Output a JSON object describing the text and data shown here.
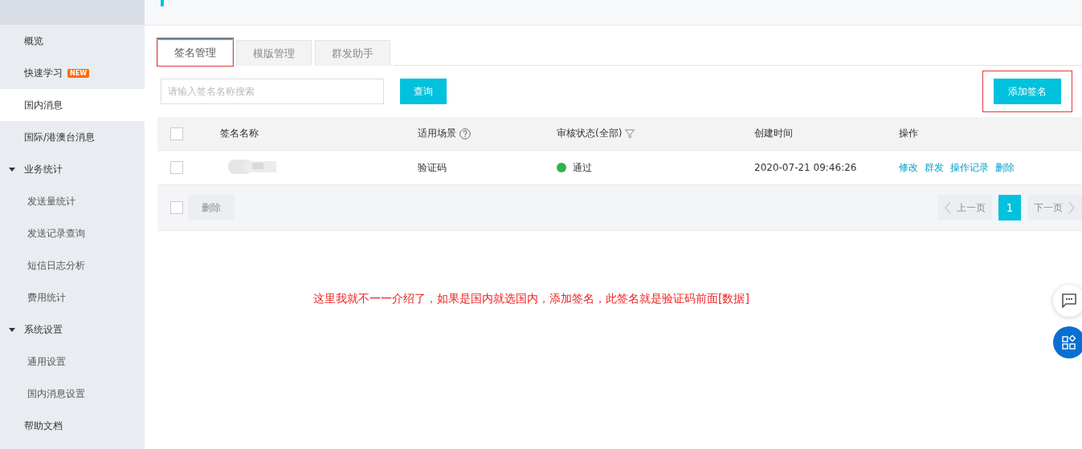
{
  "sidebar": {
    "items": [
      {
        "label": "概览",
        "selected": false
      },
      {
        "label": "快速学习",
        "badge": "NEW",
        "selected": false
      },
      {
        "label": "国内消息",
        "selected": true
      },
      {
        "label": "国际/港澳台消息",
        "selected": false
      },
      {
        "label": "业务统计",
        "expanded": true,
        "children": [
          {
            "label": "发送量统计",
            "selected": false
          },
          {
            "label": "发送记录查询",
            "selected": false
          },
          {
            "label": "短信日志分析",
            "selected": false
          },
          {
            "label": "费用统计",
            "selected": false
          }
        ]
      },
      {
        "label": "系统设置",
        "expanded": true,
        "children": [
          {
            "label": "通用设置",
            "selected": false
          },
          {
            "label": "国内消息设置",
            "selected": false
          }
        ]
      },
      {
        "label": "帮助文档",
        "selected": false
      }
    ]
  },
  "tabs": [
    {
      "label": "签名管理",
      "selected": true,
      "highlighted": true
    },
    {
      "label": "模版管理",
      "selected": false,
      "highlighted": false
    },
    {
      "label": "群发助手",
      "selected": false,
      "highlighted": false
    }
  ],
  "search": {
    "placeholder": "请输入签名名称搜索",
    "button": "查询"
  },
  "add_button": {
    "label": "添加签名",
    "highlighted": true
  },
  "table": {
    "all_checked": false,
    "columns": [
      {
        "label": "签名名称",
        "kind": "plain"
      },
      {
        "label": "适用场景",
        "kind": "help"
      },
      {
        "label": "审核状态(全部)",
        "kind": "filter"
      },
      {
        "label": "创建时间",
        "kind": "plain"
      },
      {
        "label": "操作",
        "kind": "plain"
      }
    ],
    "rows": [
      {
        "checked": false,
        "scene": "验证码",
        "status": "通过",
        "color": "#33b249",
        "created": "2020-07-21 09:46:26",
        "actions": [
          "修改",
          "群发",
          "操作记录",
          "删除"
        ]
      }
    ]
  },
  "footer": {
    "checked": false,
    "delete": "删除",
    "prev": "上一页",
    "pages": [
      {
        "label": "1",
        "selected": true
      }
    ],
    "next": "下一页"
  },
  "note": "这里我就不一一介绍了，如果是国内就选国内，添加签名，此签名就是验证码前面[数据]"
}
